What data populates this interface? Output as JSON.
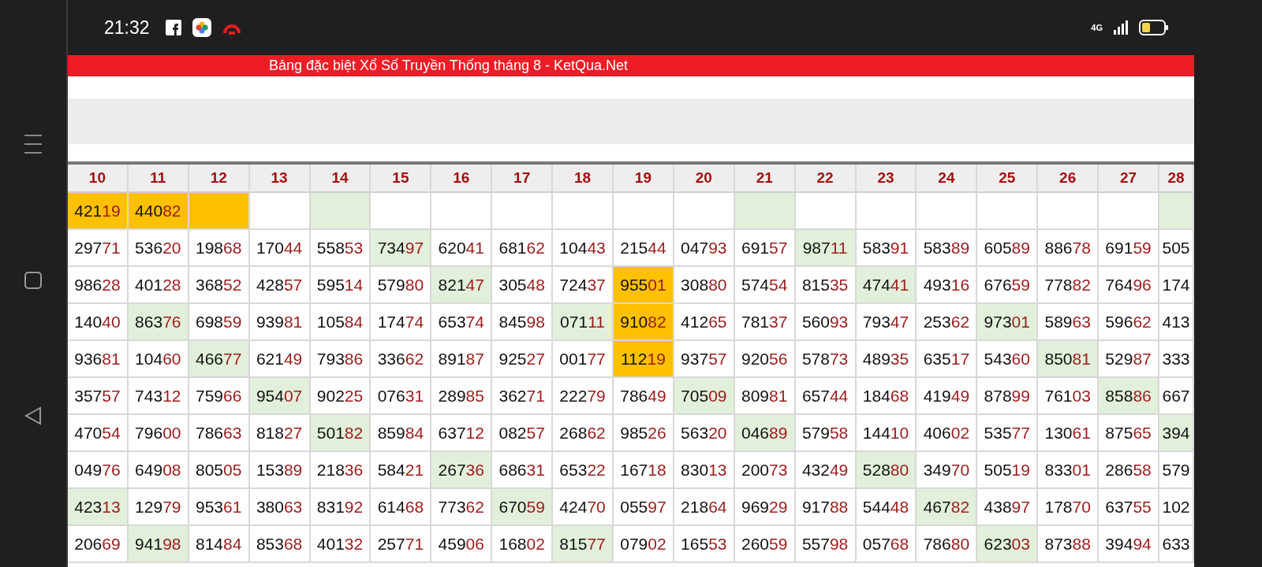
{
  "status_bar": {
    "time": "21:32",
    "network": "4G"
  },
  "banner": {
    "title": "Bảng đặc biệt Xổ Số Truyền Thống tháng 8 - KetQua.Net"
  },
  "table": {
    "columns": [
      "10",
      "11",
      "12",
      "13",
      "14",
      "15",
      "16",
      "17",
      "18",
      "19",
      "20",
      "21",
      "22",
      "23",
      "24",
      "25",
      "26",
      "27",
      "28"
    ],
    "rows": [
      {
        "cells": [
          {
            "value": "42119",
            "color": "#ffc000"
          },
          {
            "value": "44082",
            "color": "#ffc000"
          },
          {
            "color": "#ffc000"
          },
          {
            "color": "#ffffff"
          },
          {
            "color": "#e2efda"
          },
          {
            "color": "#ffffff"
          },
          {
            "color": "#ffffff"
          },
          {
            "color": "#ffffff"
          },
          {
            "color": "#ffffff"
          },
          {
            "color": "#ffffff"
          },
          {
            "color": "#ffffff"
          },
          {
            "color": "#e2efda"
          },
          {
            "color": "#ffffff"
          },
          {
            "color": "#ffffff"
          },
          {
            "color": "#ffffff"
          },
          {
            "color": "#ffffff"
          },
          {
            "color": "#ffffff"
          },
          {
            "color": "#ffffff"
          },
          {
            "color": "#e2efda"
          }
        ]
      },
      {
        "cells": [
          {
            "value": "29771",
            "color": "#ffffff"
          },
          {
            "value": "53620",
            "color": "#ffffff"
          },
          {
            "value": "19868",
            "color": "#ffffff"
          },
          {
            "value": "17044",
            "color": "#ffffff"
          },
          {
            "value": "55853",
            "color": "#ffffff"
          },
          {
            "value": "73497",
            "color": "#e2efda"
          },
          {
            "value": "62041",
            "color": "#ffffff"
          },
          {
            "value": "68162",
            "color": "#ffffff"
          },
          {
            "value": "10443",
            "color": "#ffffff"
          },
          {
            "value": "21544",
            "color": "#ffffff"
          },
          {
            "value": "04793",
            "color": "#ffffff"
          },
          {
            "value": "69157",
            "color": "#ffffff"
          },
          {
            "value": "98711",
            "color": "#e2efda"
          },
          {
            "value": "58391",
            "color": "#ffffff"
          },
          {
            "value": "58389",
            "color": "#ffffff"
          },
          {
            "value": "60589",
            "color": "#ffffff"
          },
          {
            "value": "88678",
            "color": "#ffffff"
          },
          {
            "value": "69159",
            "color": "#ffffff"
          },
          {
            "value": "505",
            "color": "#ffffff"
          }
        ]
      },
      {
        "cells": [
          {
            "value": "98628",
            "color": "#ffffff"
          },
          {
            "value": "40128",
            "color": "#ffffff"
          },
          {
            "value": "36852",
            "color": "#ffffff"
          },
          {
            "value": "42857",
            "color": "#ffffff"
          },
          {
            "value": "59514",
            "color": "#ffffff"
          },
          {
            "value": "57980",
            "color": "#ffffff"
          },
          {
            "value": "82147",
            "color": "#e2efda"
          },
          {
            "value": "30548",
            "color": "#ffffff"
          },
          {
            "value": "72437",
            "color": "#ffffff"
          },
          {
            "value": "95501",
            "color": "#ffc000"
          },
          {
            "value": "30880",
            "color": "#ffffff"
          },
          {
            "value": "57454",
            "color": "#ffffff"
          },
          {
            "value": "81535",
            "color": "#ffffff"
          },
          {
            "value": "47441",
            "color": "#e2efda"
          },
          {
            "value": "49316",
            "color": "#ffffff"
          },
          {
            "value": "67659",
            "color": "#ffffff"
          },
          {
            "value": "77882",
            "color": "#ffffff"
          },
          {
            "value": "76496",
            "color": "#ffffff"
          },
          {
            "value": "174",
            "color": "#ffffff"
          }
        ]
      },
      {
        "cells": [
          {
            "value": "14040",
            "color": "#ffffff"
          },
          {
            "value": "86376",
            "color": "#e2efda"
          },
          {
            "value": "69859",
            "color": "#ffffff"
          },
          {
            "value": "93981",
            "color": "#ffffff"
          },
          {
            "value": "10584",
            "color": "#ffffff"
          },
          {
            "value": "17474",
            "color": "#ffffff"
          },
          {
            "value": "65374",
            "color": "#ffffff"
          },
          {
            "value": "84598",
            "color": "#ffffff"
          },
          {
            "value": "07111",
            "color": "#e2efda"
          },
          {
            "value": "91082",
            "color": "#ffc000"
          },
          {
            "value": "41265",
            "color": "#ffffff"
          },
          {
            "value": "78137",
            "color": "#ffffff"
          },
          {
            "value": "56093",
            "color": "#ffffff"
          },
          {
            "value": "79347",
            "color": "#ffffff"
          },
          {
            "value": "25362",
            "color": "#ffffff"
          },
          {
            "value": "97301",
            "color": "#e2efda"
          },
          {
            "value": "58963",
            "color": "#ffffff"
          },
          {
            "value": "59662",
            "color": "#ffffff"
          },
          {
            "value": "413",
            "color": "#ffffff"
          }
        ]
      },
      {
        "cells": [
          {
            "value": "93681",
            "color": "#ffffff"
          },
          {
            "value": "10460",
            "color": "#ffffff"
          },
          {
            "value": "46677",
            "color": "#e2efda"
          },
          {
            "value": "62149",
            "color": "#ffffff"
          },
          {
            "value": "79386",
            "color": "#ffffff"
          },
          {
            "value": "33662",
            "color": "#ffffff"
          },
          {
            "value": "89187",
            "color": "#ffffff"
          },
          {
            "value": "92527",
            "color": "#ffffff"
          },
          {
            "value": "00177",
            "color": "#ffffff"
          },
          {
            "value": "11219",
            "color": "#ffc000"
          },
          {
            "value": "93757",
            "color": "#ffffff"
          },
          {
            "value": "92056",
            "color": "#ffffff"
          },
          {
            "value": "57873",
            "color": "#ffffff"
          },
          {
            "value": "48935",
            "color": "#ffffff"
          },
          {
            "value": "63517",
            "color": "#ffffff"
          },
          {
            "value": "54360",
            "color": "#ffffff"
          },
          {
            "value": "85081",
            "color": "#e2efda"
          },
          {
            "value": "52987",
            "color": "#ffffff"
          },
          {
            "value": "333",
            "color": "#ffffff"
          }
        ]
      },
      {
        "cells": [
          {
            "value": "35757",
            "color": "#ffffff"
          },
          {
            "value": "74312",
            "color": "#ffffff"
          },
          {
            "value": "75966",
            "color": "#ffffff"
          },
          {
            "value": "95407",
            "color": "#e2efda"
          },
          {
            "value": "90225",
            "color": "#ffffff"
          },
          {
            "value": "07631",
            "color": "#ffffff"
          },
          {
            "value": "28985",
            "color": "#ffffff"
          },
          {
            "value": "36271",
            "color": "#ffffff"
          },
          {
            "value": "22279",
            "color": "#ffffff"
          },
          {
            "value": "78649",
            "color": "#ffffff"
          },
          {
            "value": "70509",
            "color": "#e2efda"
          },
          {
            "value": "80981",
            "color": "#ffffff"
          },
          {
            "value": "65744",
            "color": "#ffffff"
          },
          {
            "value": "18468",
            "color": "#ffffff"
          },
          {
            "value": "41949",
            "color": "#ffffff"
          },
          {
            "value": "87899",
            "color": "#ffffff"
          },
          {
            "value": "76103",
            "color": "#ffffff"
          },
          {
            "value": "85886",
            "color": "#e2efda"
          },
          {
            "value": "667",
            "color": "#ffffff"
          }
        ]
      },
      {
        "cells": [
          {
            "value": "47054",
            "color": "#ffffff"
          },
          {
            "value": "79600",
            "color": "#ffffff"
          },
          {
            "value": "78663",
            "color": "#ffffff"
          },
          {
            "value": "81827",
            "color": "#ffffff"
          },
          {
            "value": "50182",
            "color": "#e2efda"
          },
          {
            "value": "85984",
            "color": "#ffffff"
          },
          {
            "value": "63712",
            "color": "#ffffff"
          },
          {
            "value": "08257",
            "color": "#ffffff"
          },
          {
            "value": "26862",
            "color": "#ffffff"
          },
          {
            "value": "98526",
            "color": "#ffffff"
          },
          {
            "value": "56320",
            "color": "#ffffff"
          },
          {
            "value": "04689",
            "color": "#e2efda"
          },
          {
            "value": "57958",
            "color": "#ffffff"
          },
          {
            "value": "14410",
            "color": "#ffffff"
          },
          {
            "value": "40602",
            "color": "#ffffff"
          },
          {
            "value": "53577",
            "color": "#ffffff"
          },
          {
            "value": "13061",
            "color": "#ffffff"
          },
          {
            "value": "87565",
            "color": "#ffffff"
          },
          {
            "value": "394",
            "color": "#e2efda"
          }
        ]
      },
      {
        "cells": [
          {
            "value": "04976",
            "color": "#ffffff"
          },
          {
            "value": "64908",
            "color": "#ffffff"
          },
          {
            "value": "80505",
            "color": "#ffffff"
          },
          {
            "value": "15389",
            "color": "#ffffff"
          },
          {
            "value": "21836",
            "color": "#ffffff"
          },
          {
            "value": "58421",
            "color": "#ffffff"
          },
          {
            "value": "26736",
            "color": "#e2efda"
          },
          {
            "value": "68631",
            "color": "#ffffff"
          },
          {
            "value": "65322",
            "color": "#ffffff"
          },
          {
            "value": "16718",
            "color": "#ffffff"
          },
          {
            "value": "83013",
            "color": "#ffffff"
          },
          {
            "value": "20073",
            "color": "#ffffff"
          },
          {
            "value": "43249",
            "color": "#ffffff"
          },
          {
            "value": "52880",
            "color": "#e2efda"
          },
          {
            "value": "34970",
            "color": "#ffffff"
          },
          {
            "value": "50519",
            "color": "#ffffff"
          },
          {
            "value": "83301",
            "color": "#ffffff"
          },
          {
            "value": "28658",
            "color": "#ffffff"
          },
          {
            "value": "579",
            "color": "#ffffff"
          }
        ]
      },
      {
        "cells": [
          {
            "value": "42313",
            "color": "#e2efda"
          },
          {
            "value": "12979",
            "color": "#ffffff"
          },
          {
            "value": "95361",
            "color": "#ffffff"
          },
          {
            "value": "38063",
            "color": "#ffffff"
          },
          {
            "value": "83192",
            "color": "#ffffff"
          },
          {
            "value": "61468",
            "color": "#ffffff"
          },
          {
            "value": "77362",
            "color": "#ffffff"
          },
          {
            "value": "67059",
            "color": "#e2efda"
          },
          {
            "value": "42470",
            "color": "#ffffff"
          },
          {
            "value": "05597",
            "color": "#ffffff"
          },
          {
            "value": "21864",
            "color": "#ffffff"
          },
          {
            "value": "96929",
            "color": "#ffffff"
          },
          {
            "value": "91788",
            "color": "#ffffff"
          },
          {
            "value": "54448",
            "color": "#ffffff"
          },
          {
            "value": "46782",
            "color": "#e2efda"
          },
          {
            "value": "43897",
            "color": "#ffffff"
          },
          {
            "value": "17870",
            "color": "#ffffff"
          },
          {
            "value": "63755",
            "color": "#ffffff"
          },
          {
            "value": "102",
            "color": "#ffffff"
          }
        ]
      },
      {
        "cells": [
          {
            "value": "20669",
            "color": "#ffffff"
          },
          {
            "value": "94198",
            "color": "#e2efda"
          },
          {
            "value": "81484",
            "color": "#ffffff"
          },
          {
            "value": "85368",
            "color": "#ffffff"
          },
          {
            "value": "40132",
            "color": "#ffffff"
          },
          {
            "value": "25771",
            "color": "#ffffff"
          },
          {
            "value": "45906",
            "color": "#ffffff"
          },
          {
            "value": "16802",
            "color": "#ffffff"
          },
          {
            "value": "81577",
            "color": "#e2efda"
          },
          {
            "value": "07902",
            "color": "#ffffff"
          },
          {
            "value": "16553",
            "color": "#ffffff"
          },
          {
            "value": "26059",
            "color": "#ffffff"
          },
          {
            "value": "55798",
            "color": "#ffffff"
          },
          {
            "value": "05768",
            "color": "#ffffff"
          },
          {
            "value": "78680",
            "color": "#ffffff"
          },
          {
            "value": "62303",
            "color": "#e2efda"
          },
          {
            "value": "87388",
            "color": "#ffffff"
          },
          {
            "value": "39494",
            "color": "#ffffff"
          },
          {
            "value": "633",
            "color": "#ffffff"
          }
        ]
      }
    ]
  }
}
